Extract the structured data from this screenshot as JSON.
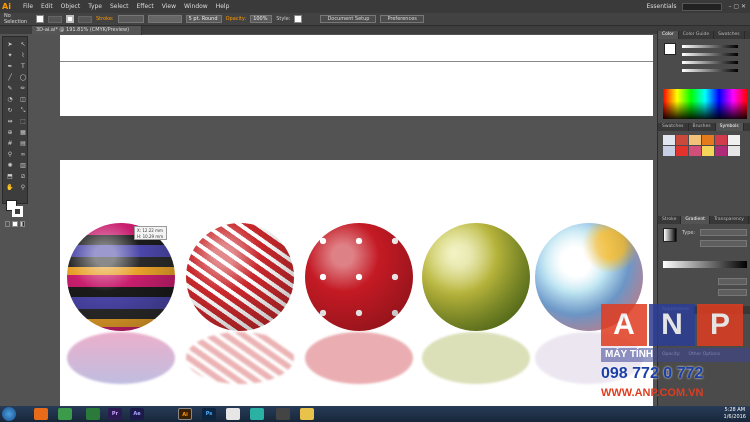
{
  "app": {
    "logo": "Ai",
    "workspace": "Essentials"
  },
  "menu": [
    "File",
    "Edit",
    "Object",
    "Type",
    "Select",
    "Effect",
    "View",
    "Window",
    "Help"
  ],
  "control": {
    "selection": "No Selection",
    "stroke_label": "Stroke:",
    "brush": "5 pt. Round",
    "opacity_label": "Opacity:",
    "opacity": "100%",
    "style_label": "Style:",
    "doc_setup": "Document Setup",
    "preferences": "Preferences"
  },
  "tab": {
    "title": "3D-ai.ai* @ 191.81% (CMYK/Preview)"
  },
  "tooltip": {
    "line1": "X: 12.22 mm",
    "line2": "H: 10.29 mm"
  },
  "panels": {
    "color_tabs": [
      "Color",
      "Color Guide",
      "Swatches"
    ],
    "swatch_tabs": [
      "Swatches",
      "Brushes",
      "Symbols"
    ],
    "grad_tabs": [
      "Stroke",
      "Gradient",
      "Transparency"
    ],
    "gradient_type_label": "Type:",
    "appearance_label": "Appearance",
    "opacity_row": "Opacity:",
    "other_options": "Other Options"
  },
  "taskbar": {
    "apps": [
      "Pr",
      "Ae",
      "Ai",
      "Ps"
    ],
    "time": "5:28 AM",
    "date": "1/6/2016"
  },
  "watermark": {
    "letters": [
      "A",
      "N",
      "P"
    ],
    "line1": "MÁY TÍNH",
    "line2": "098 772 0 772",
    "line3": "WWW.ANP.COM.VN"
  },
  "colors": {
    "accent": "#ff9a00",
    "anp_red": "#e03c20",
    "anp_blue": "#2c3d96"
  }
}
